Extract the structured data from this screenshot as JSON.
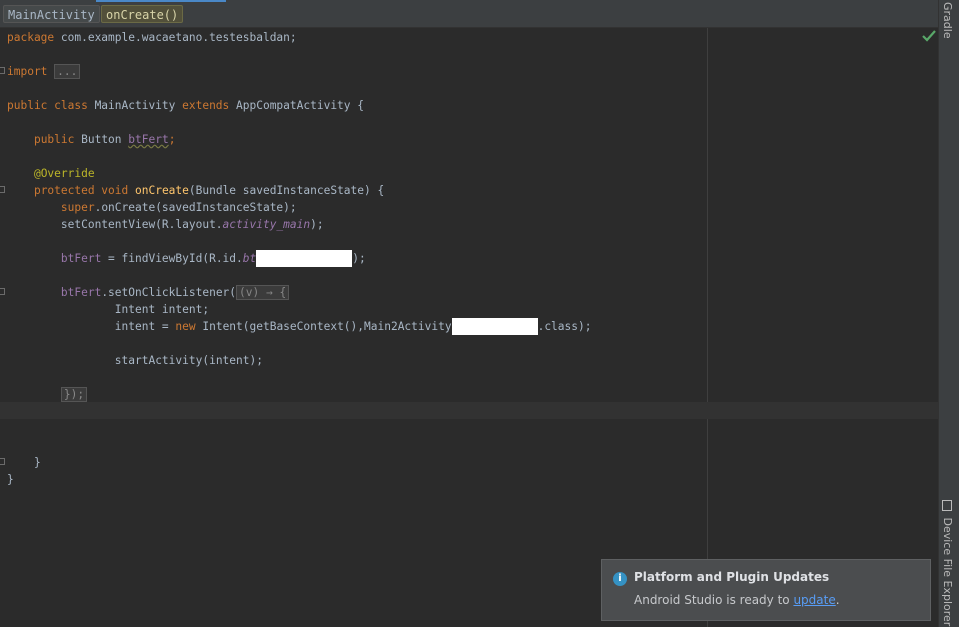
{
  "breadcrumbs": [
    {
      "label": "MainActivity"
    },
    {
      "label": "onCreate()"
    }
  ],
  "side_tabs": {
    "gradle": "Gradle",
    "device_file_explorer": "Device File Explorer"
  },
  "code": {
    "line1": {
      "kw": "package",
      "rest": " com.example.wacaetano.testesbaldan;"
    },
    "line2": {
      "kw": "import",
      "fold": "..."
    },
    "line3": {
      "kw1": "public class",
      "name": " MainActivity ",
      "kw2": "extends",
      "rest": " AppCompatActivity {"
    },
    "line4": {
      "kw": "public",
      "type": " Button ",
      "field": "btFert",
      "end": ";"
    },
    "line5": {
      "ann": "@Override"
    },
    "line6": {
      "kw": "protected void",
      "method": "onCreate",
      "rest": "(Bundle savedInstanceState) {"
    },
    "line7": {
      "kw": "super",
      "rest": ".onCreate(savedInstanceState);"
    },
    "line8": {
      "pre": "setContentView(R.layout.",
      "it": "activity_main",
      "post": ");"
    },
    "line9": {
      "field": "btFert",
      "pre": " = findViewById(R.id.",
      "it": "bt",
      "post": ");"
    },
    "line10": {
      "field": "btFert",
      "pre": ".setOnClickListener(",
      "lambda": "(v) → {"
    },
    "line11": {
      "text": "Intent intent;"
    },
    "line12": {
      "pre": "intent = ",
      "kw": "new",
      "mid": " Intent(getBaseContext(),Main2Activity",
      "post": ".class);"
    },
    "line13": {
      "text": "startActivity(intent);"
    },
    "line14": {
      "text": "});"
    },
    "line15": {
      "text": "}"
    },
    "line16": {
      "text": "}"
    }
  },
  "notification": {
    "title": "Platform and Plugin Updates",
    "body_prefix": "Android Studio is ready to ",
    "link": "update",
    "body_suffix": "."
  },
  "colors": {
    "keyword": "#cc7832",
    "annotation": "#bbb529",
    "field": "#9876aa",
    "method": "#ffc66d",
    "text": "#a9b7c6",
    "background": "#2b2b2b"
  }
}
